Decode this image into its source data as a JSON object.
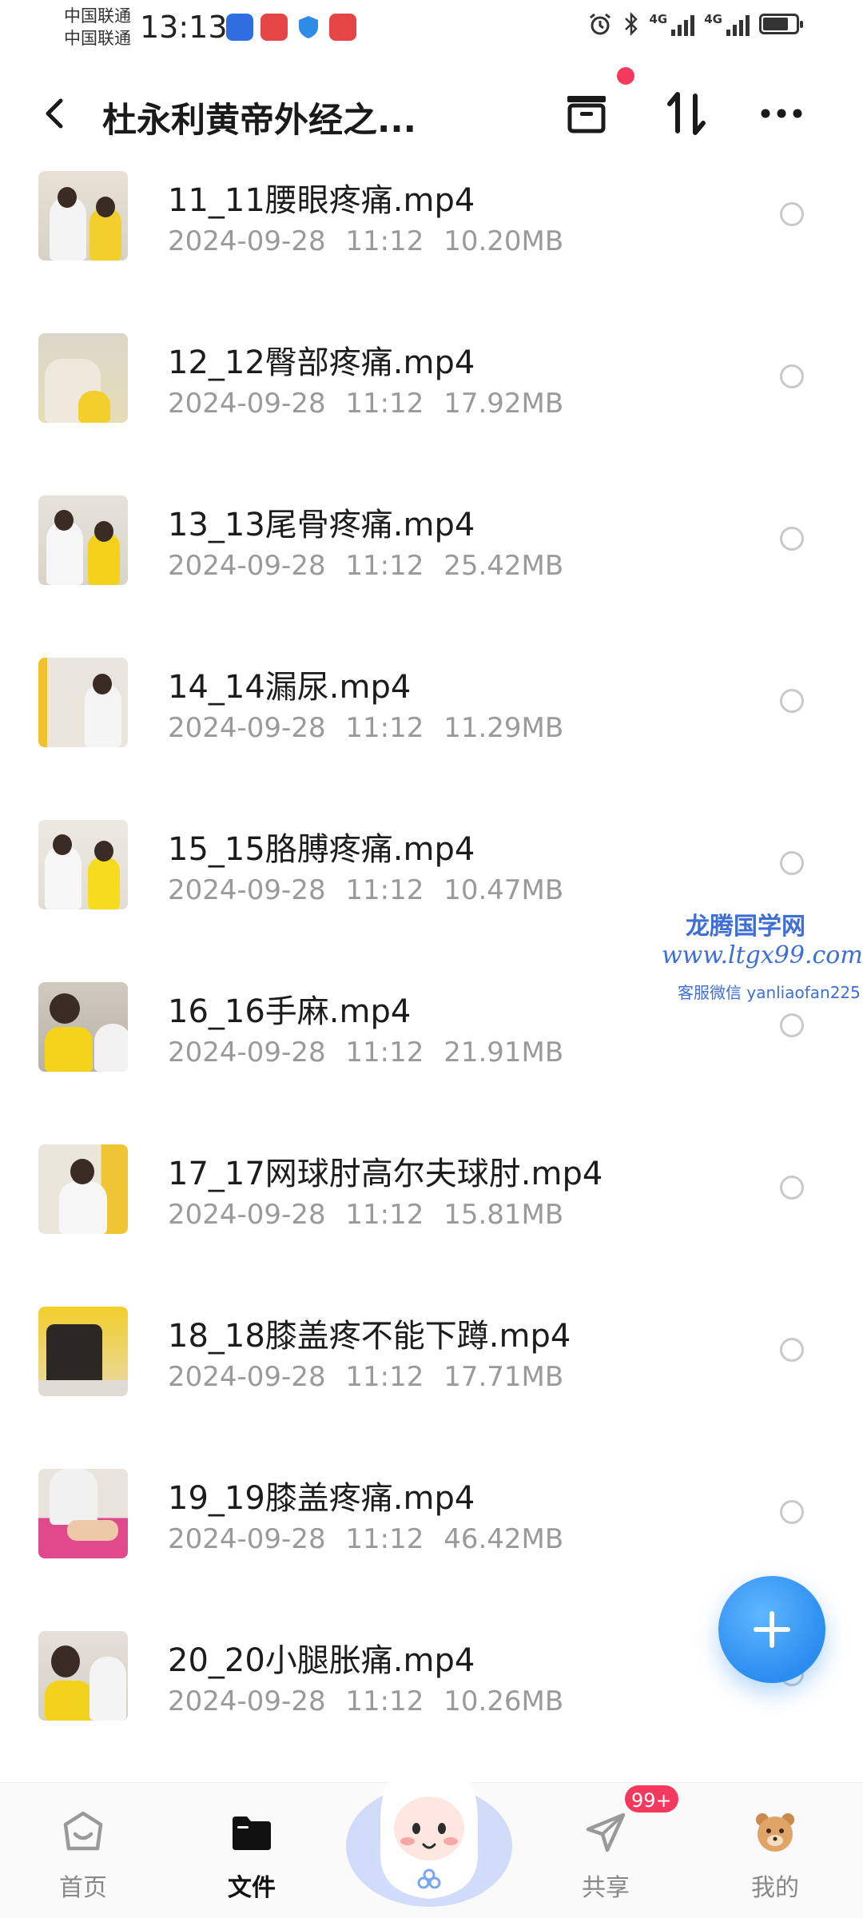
{
  "status_bar": {
    "carrier_1": "中国联通",
    "carrier_2": "中国联通",
    "time": "13:13",
    "network_1": "4G",
    "network_2": "4G"
  },
  "header": {
    "title": "杜永利黄帝外经之..."
  },
  "files": [
    {
      "name": "11_11腰眼疼痛.mp4",
      "meta": "2024-09-28 11:12 10.20MB"
    },
    {
      "name": "12_12臀部疼痛.mp4",
      "meta": "2024-09-28 11:12 17.92MB"
    },
    {
      "name": "13_13尾骨疼痛.mp4",
      "meta": "2024-09-28 11:12 25.42MB"
    },
    {
      "name": "14_14漏尿.mp4",
      "meta": "2024-09-28 11:12 11.29MB"
    },
    {
      "name": "15_15胳膊疼痛.mp4",
      "meta": "2024-09-28 11:12 10.47MB"
    },
    {
      "name": "16_16手麻.mp4",
      "meta": "2024-09-28 11:12 21.91MB"
    },
    {
      "name": "17_17网球肘高尔夫球肘.mp4",
      "meta": "2024-09-28 11:12 15.81MB"
    },
    {
      "name": "18_18膝盖疼不能下蹲.mp4",
      "meta": "2024-09-28 11:12 17.71MB"
    },
    {
      "name": "19_19膝盖疼痛.mp4",
      "meta": "2024-09-28 11:12 46.42MB"
    },
    {
      "name": "20_20小腿胀痛.mp4",
      "meta": "2024-09-28 11:12 10.26MB"
    }
  ],
  "watermark": {
    "line_1": "龙腾国学网",
    "line_2": "www.ltgx99.com",
    "line_3": "客服微信 yanliaofan225"
  },
  "nav": {
    "home": "首页",
    "files": "文件",
    "share": "共享",
    "share_badge": "99+",
    "mine": "我的"
  },
  "icons": {
    "back": "chevron-left-icon",
    "archive": "archive-box-icon",
    "sort": "sort-arrows-icon",
    "more": "more-dots-icon",
    "fab": "plus-icon",
    "home": "home-icon",
    "files": "folder-icon",
    "share": "paper-plane-icon",
    "mine": "bear-avatar-icon"
  },
  "colors": {
    "accent": "#2c8df0",
    "badge": "#f5385e",
    "meta_text": "#9a9a9a",
    "watermark": "#3e6ed6"
  }
}
